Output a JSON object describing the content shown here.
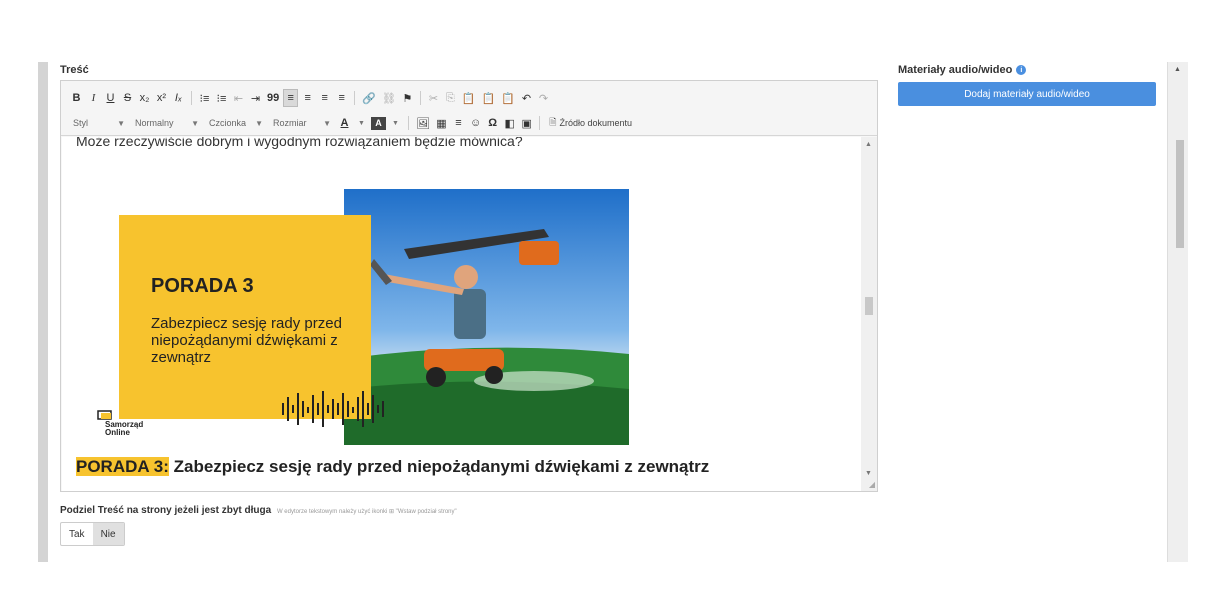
{
  "form": {
    "content_label": "Treść",
    "toolbar": {
      "row1": [
        "B",
        "I",
        "U",
        "S",
        "x₂",
        "x²",
        "Iₓ",
        "⁝≡",
        "⁝≡",
        "⇤",
        "⇥",
        "99",
        "≡",
        "≡",
        "≡",
        "≡",
        "🔗",
        "⛓",
        "⚑",
        "✂",
        "⎘",
        "📋",
        "📋",
        "📋",
        "↶",
        "↷"
      ],
      "style_combo": "Styl",
      "format_combo": "Normalny",
      "font_combo": "Czcionka",
      "size_combo": "Rozmiar",
      "text_color": "A",
      "bg_color": "A",
      "row2_icons": [
        "🖼",
        "▦",
        "≡",
        "☺",
        "Ω",
        "◧",
        "▣"
      ],
      "source_label": "Źródło dokumentu"
    },
    "editor": {
      "top_text": "Może rzeczywiście dobrym i wygodnym rozwiązaniem będzie mównica?",
      "image": {
        "title": "PORADA 3",
        "subtitle": "Zabezpiecz sesję rady przed niepożądanymi dźwiękami z zewnątrz",
        "logo_line1": "Samorząd",
        "logo_line2": "Online"
      },
      "heading_highlight": "PORADA 3:",
      "heading_rest": " Zabezpiecz sesję rady przed niepożądanymi dźwiękami z zewnątrz"
    },
    "split": {
      "label": "Podziel Treść na strony jeżeli jest zbyt długa",
      "hint": "W edytorze tekstowym należy użyć ikonki ⊞ \"Wstaw podział strony\"",
      "options": [
        "Tak",
        "Nie"
      ],
      "selected": "Nie"
    },
    "media": {
      "label": "Materiały audio/wideo",
      "button": "Dodaj materiały audio/wideo"
    }
  },
  "colors": {
    "accent_blue": "#4a8fdf",
    "highlight_yellow": "#f7c32e"
  }
}
